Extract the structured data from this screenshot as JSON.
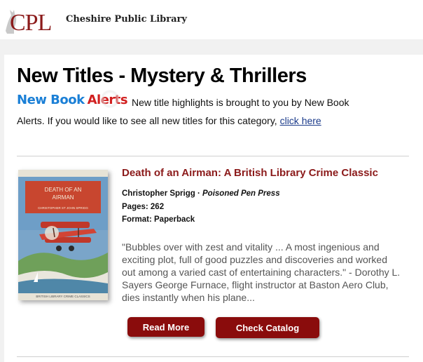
{
  "header": {
    "logo_text": "CPL",
    "library_name": "Cheshire Public Library"
  },
  "main": {
    "title": "New Titles - Mystery & Thrillers",
    "new_book_alerts_logo": {
      "word1": "New Book",
      "word2": "Alerts"
    },
    "intro_line1": "New title highlights is brought to you by New Book",
    "intro_line2_prefix": "Alerts. If you would like to see all new titles for this category,",
    "intro_link": "click here"
  },
  "book": {
    "title": "Death of an Airman: A British Library Crime Classic",
    "author": "Christopher Sprigg",
    "separator": " · ",
    "publisher": "Poisoned Pen Press",
    "pages_label": "Pages: 262",
    "format_label": "Format: Paperback",
    "description": "\"Bubbles over with zest and vitality ... A most ingenious and exciting plot, full of good puzzles and discoveries and worked out among a varied cast of entertaining characters.\" - Dorothy L. Sayers George Furnace, flight instructor at Baston Aero Club, dies instantly when his plane...",
    "cover": {
      "title_line1": "DEATH OF AN",
      "title_line2": "AIRMAN",
      "author_line": "CHRISTOPHER ST JOHN SPRIGG",
      "series_line": "BRITISH LIBRARY CRIME CLASSICS"
    }
  },
  "buttons": {
    "read_more": "Read More",
    "check_catalog": "Check Catalog"
  },
  "colors": {
    "accent": "#8b1a1a",
    "button": "#8a0c0c",
    "background": "#f1f1f1",
    "link": "#1a3a8a"
  }
}
